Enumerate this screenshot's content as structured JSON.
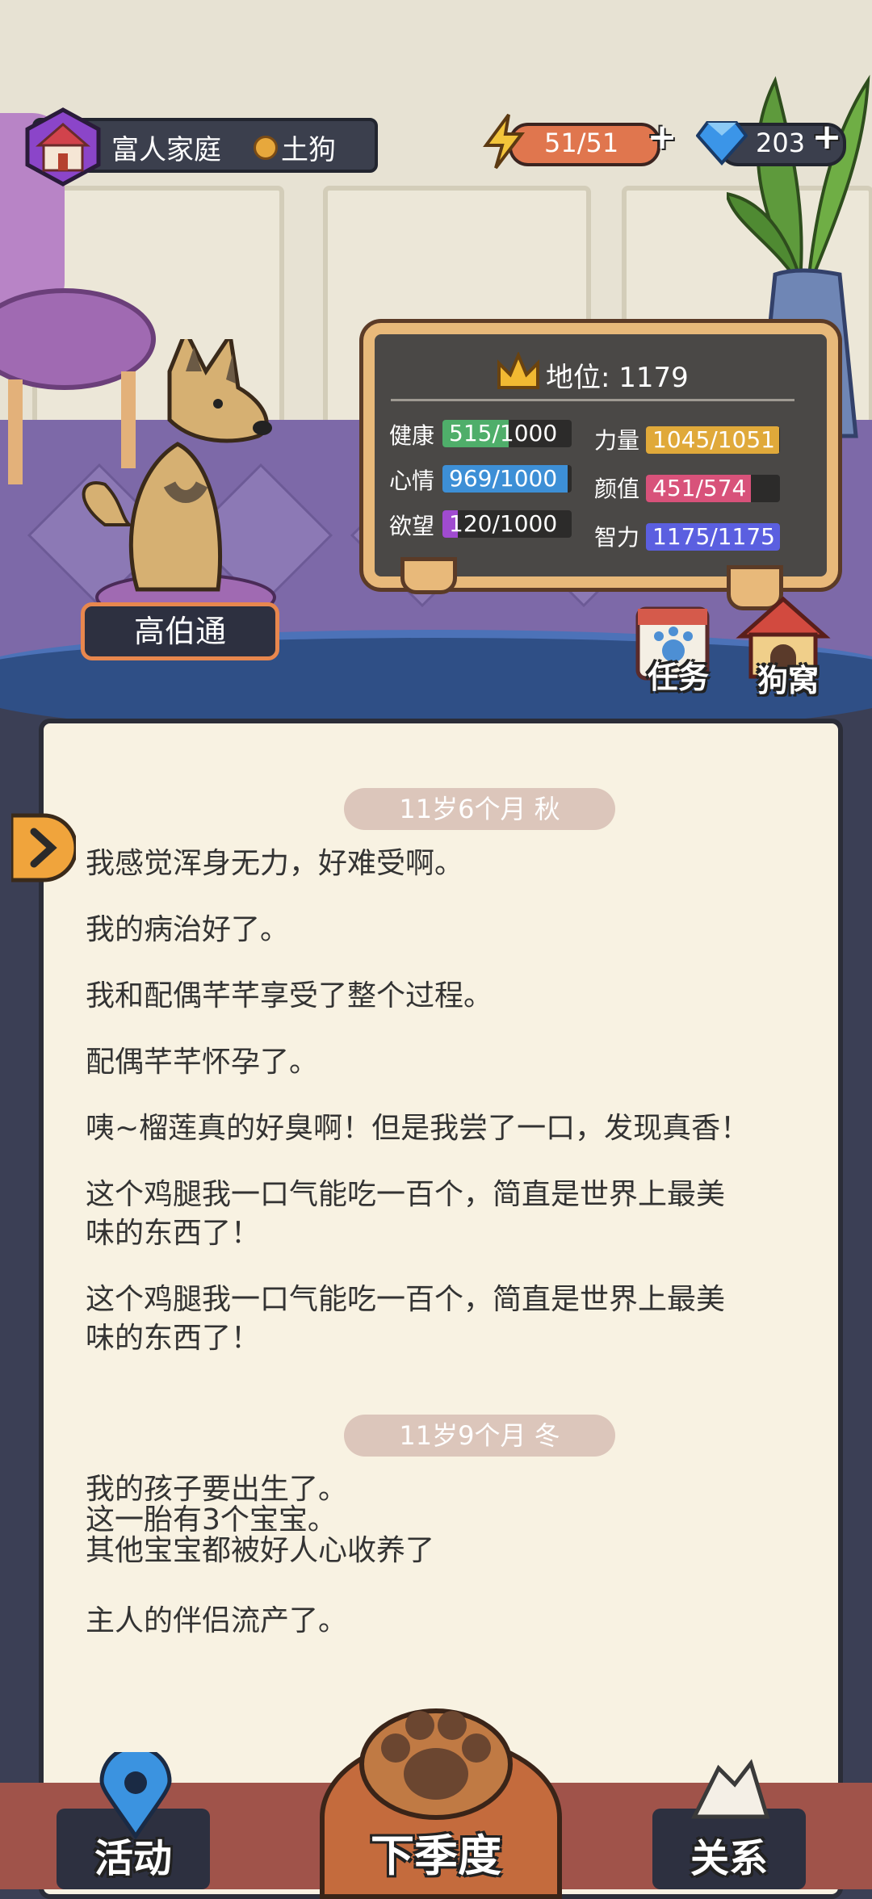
{
  "header": {
    "family_label": "富人家庭",
    "breed_label": "土狗",
    "energy": "51/51",
    "gems": "203"
  },
  "pet": {
    "name": "高伯通"
  },
  "stats": {
    "status_label": "地位: 1179",
    "health_label": "健康",
    "health": "515/1000",
    "health_frac": 0.515,
    "strength_label": "力量",
    "strength": "1045/1051",
    "strength_frac": 0.994,
    "mood_label": "心情",
    "mood": "969/1000",
    "mood_frac": 0.969,
    "looks_label": "颜值",
    "looks": "451/574",
    "looks_frac": 0.786,
    "desire_label": "欲望",
    "desire": "120/1000",
    "desire_frac": 0.12,
    "intellect_label": "智力",
    "intellect": "1175/1175",
    "intellect_frac": 1.0
  },
  "shortcuts": {
    "tasks": "任务",
    "kennel": "狗窝"
  },
  "journal": {
    "entry1": {
      "date": "11岁6个月 秋",
      "lines": [
        "我感觉浑身无力，好难受啊。",
        "我的病治好了。",
        "我和配偶芊芊享受了整个过程。",
        "配偶芊芊怀孕了。",
        "咦~榴莲真的好臭啊！但是我尝了一口，发现真香！",
        "这个鸡腿我一口气能吃一百个，简直是世界上最美",
        "味的东西了！",
        "这个鸡腿我一口气能吃一百个，简直是世界上最美",
        "味的东西了！"
      ]
    },
    "entry2": {
      "date": "11岁9个月 冬",
      "lines": [
        "我的孩子要出生了。",
        "这一胎有3个宝宝。",
        "其他宝宝都被好人心收养了",
        "主人的伴侣流产了。"
      ]
    }
  },
  "nav": {
    "activity": "活动",
    "next_season": "下季度",
    "relations": "关系"
  },
  "colors": {
    "health": "#4fae6a",
    "strength": "#e0a93a",
    "mood": "#3d8fd6",
    "looks": "#d8527a",
    "desire": "#a04bd0",
    "intellect": "#5b5fe0"
  }
}
